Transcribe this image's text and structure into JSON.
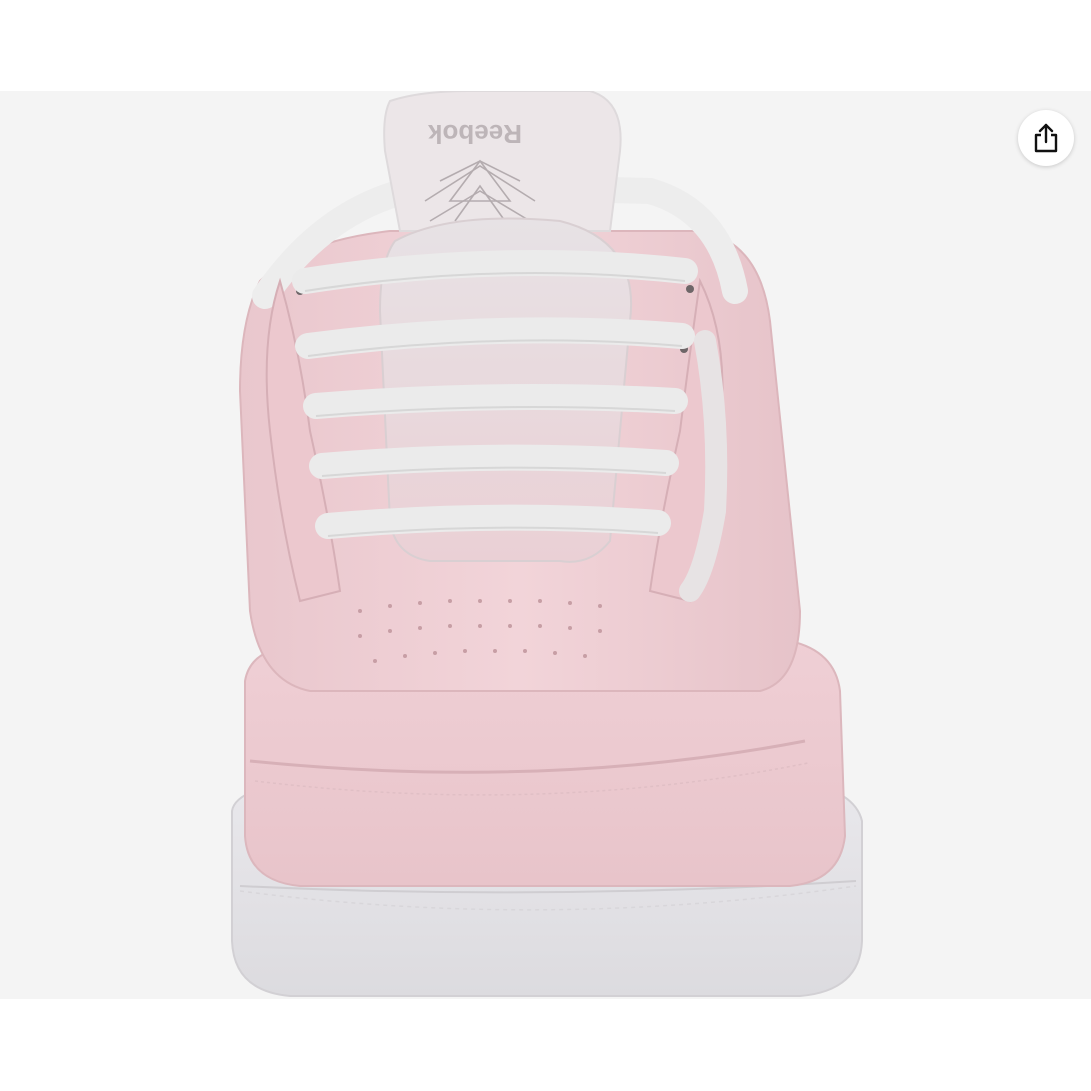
{
  "product_image": {
    "subject": "shoe-front-view",
    "brand_mark": "Reebok",
    "colors": {
      "background": "#f4f4f4",
      "upper": "#ecc9cf",
      "laces": "#eeeeee",
      "sole": "#e3e2e6",
      "logo": "#b7b0b3"
    }
  },
  "share_button": {
    "icon": "share-icon"
  }
}
